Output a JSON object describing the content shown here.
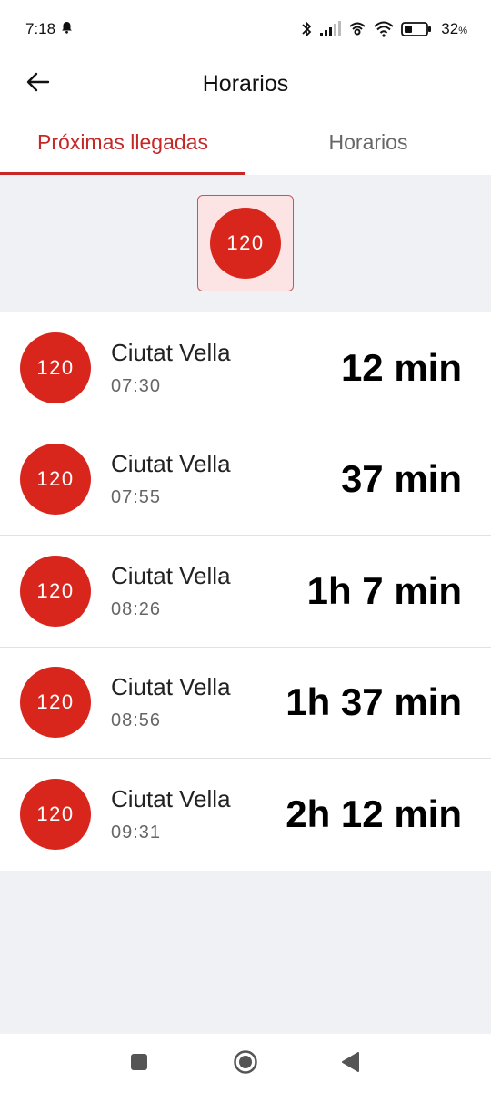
{
  "status_bar": {
    "time": "7:18",
    "battery_percent": "32",
    "battery_unit": "%"
  },
  "app_bar": {
    "title": "Horarios"
  },
  "tabs": [
    {
      "label": "Próximas llegadas",
      "active": true
    },
    {
      "label": "Horarios",
      "active": false
    }
  ],
  "filter": {
    "line": "120"
  },
  "arrivals": [
    {
      "line": "120",
      "destination": "Ciutat Vella",
      "time": "07:30",
      "eta": "12 min"
    },
    {
      "line": "120",
      "destination": "Ciutat Vella",
      "time": "07:55",
      "eta": "37 min"
    },
    {
      "line": "120",
      "destination": "Ciutat Vella",
      "time": "08:26",
      "eta": "1h 7 min"
    },
    {
      "line": "120",
      "destination": "Ciutat Vella",
      "time": "08:56",
      "eta": "1h 37 min"
    },
    {
      "line": "120",
      "destination": "Ciutat Vella",
      "time": "09:31",
      "eta": "2h 12 min"
    }
  ],
  "colors": {
    "accent": "#c62828",
    "line_badge": "#d9261c",
    "filter_chip_bg": "#fde4e4",
    "background": "#f0f1f5"
  },
  "icons": {
    "back": "arrow-left-icon",
    "notification": "bell-icon",
    "bluetooth": "bluetooth-icon",
    "signal": "signal-icon",
    "hotspot": "hotspot-icon",
    "wifi": "wifi-icon",
    "battery": "battery-icon",
    "nav_recents": "square-icon",
    "nav_home": "circle-icon",
    "nav_back": "triangle-icon"
  }
}
